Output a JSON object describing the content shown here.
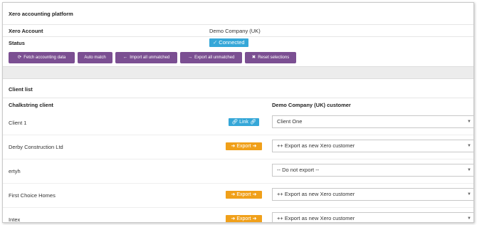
{
  "platform": {
    "title": "Xero accounting platform",
    "account_label": "Xero Account",
    "account_value": "Demo Company (UK)",
    "status_label": "Status",
    "status_value": "Connected"
  },
  "actions": [
    {
      "label": "Fetch accounting data",
      "icon": "refresh-icon"
    },
    {
      "label": "Auto match",
      "icon": ""
    },
    {
      "label": "Import all unmatched",
      "icon": "arrow-left-icon"
    },
    {
      "label": "Export all unmatched",
      "icon": "arrow-right-icon"
    },
    {
      "label": "Reset selections",
      "icon": "close-icon"
    }
  ],
  "client_list": {
    "title": "Client list",
    "col_client": "Chalkstring client",
    "col_customer": "Demo Company (UK) customer",
    "link_label": "Link",
    "export_label": "Export",
    "rows": [
      {
        "name": "Client 1",
        "action": "link",
        "selected": "Client One"
      },
      {
        "name": "Derby Construction Ltd",
        "action": "export",
        "selected": "++ Export as new Xero customer"
      },
      {
        "name": "ertyh",
        "action": "none",
        "selected": "-- Do not export --"
      },
      {
        "name": "First Choice Homes",
        "action": "export",
        "selected": "++ Export as new Xero customer"
      },
      {
        "name": "Intex",
        "action": "export",
        "selected": "++ Export as new Xero customer"
      }
    ]
  },
  "colors": {
    "primary": "#7b4f92",
    "info": "#35a7d8",
    "warning": "#f0a01a"
  }
}
